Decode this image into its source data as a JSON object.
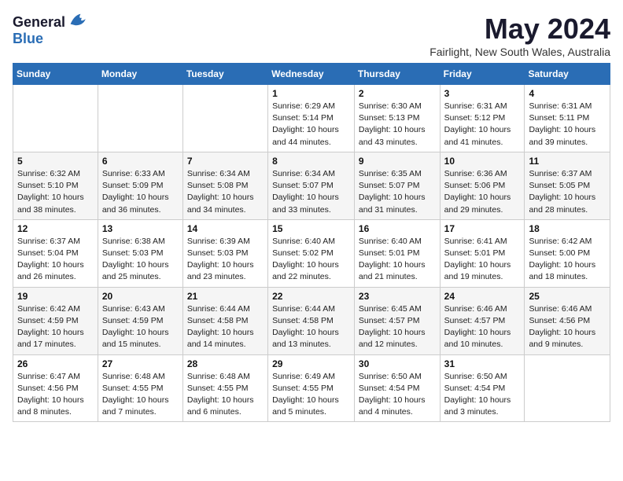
{
  "logo": {
    "general": "General",
    "blue": "Blue"
  },
  "title": "May 2024",
  "location": "Fairlight, New South Wales, Australia",
  "days_of_week": [
    "Sunday",
    "Monday",
    "Tuesday",
    "Wednesday",
    "Thursday",
    "Friday",
    "Saturday"
  ],
  "weeks": [
    [
      {
        "day": "",
        "info": ""
      },
      {
        "day": "",
        "info": ""
      },
      {
        "day": "",
        "info": ""
      },
      {
        "day": "1",
        "info": "Sunrise: 6:29 AM\nSunset: 5:14 PM\nDaylight: 10 hours and 44 minutes."
      },
      {
        "day": "2",
        "info": "Sunrise: 6:30 AM\nSunset: 5:13 PM\nDaylight: 10 hours and 43 minutes."
      },
      {
        "day": "3",
        "info": "Sunrise: 6:31 AM\nSunset: 5:12 PM\nDaylight: 10 hours and 41 minutes."
      },
      {
        "day": "4",
        "info": "Sunrise: 6:31 AM\nSunset: 5:11 PM\nDaylight: 10 hours and 39 minutes."
      }
    ],
    [
      {
        "day": "5",
        "info": "Sunrise: 6:32 AM\nSunset: 5:10 PM\nDaylight: 10 hours and 38 minutes."
      },
      {
        "day": "6",
        "info": "Sunrise: 6:33 AM\nSunset: 5:09 PM\nDaylight: 10 hours and 36 minutes."
      },
      {
        "day": "7",
        "info": "Sunrise: 6:34 AM\nSunset: 5:08 PM\nDaylight: 10 hours and 34 minutes."
      },
      {
        "day": "8",
        "info": "Sunrise: 6:34 AM\nSunset: 5:07 PM\nDaylight: 10 hours and 33 minutes."
      },
      {
        "day": "9",
        "info": "Sunrise: 6:35 AM\nSunset: 5:07 PM\nDaylight: 10 hours and 31 minutes."
      },
      {
        "day": "10",
        "info": "Sunrise: 6:36 AM\nSunset: 5:06 PM\nDaylight: 10 hours and 29 minutes."
      },
      {
        "day": "11",
        "info": "Sunrise: 6:37 AM\nSunset: 5:05 PM\nDaylight: 10 hours and 28 minutes."
      }
    ],
    [
      {
        "day": "12",
        "info": "Sunrise: 6:37 AM\nSunset: 5:04 PM\nDaylight: 10 hours and 26 minutes."
      },
      {
        "day": "13",
        "info": "Sunrise: 6:38 AM\nSunset: 5:03 PM\nDaylight: 10 hours and 25 minutes."
      },
      {
        "day": "14",
        "info": "Sunrise: 6:39 AM\nSunset: 5:03 PM\nDaylight: 10 hours and 23 minutes."
      },
      {
        "day": "15",
        "info": "Sunrise: 6:40 AM\nSunset: 5:02 PM\nDaylight: 10 hours and 22 minutes."
      },
      {
        "day": "16",
        "info": "Sunrise: 6:40 AM\nSunset: 5:01 PM\nDaylight: 10 hours and 21 minutes."
      },
      {
        "day": "17",
        "info": "Sunrise: 6:41 AM\nSunset: 5:01 PM\nDaylight: 10 hours and 19 minutes."
      },
      {
        "day": "18",
        "info": "Sunrise: 6:42 AM\nSunset: 5:00 PM\nDaylight: 10 hours and 18 minutes."
      }
    ],
    [
      {
        "day": "19",
        "info": "Sunrise: 6:42 AM\nSunset: 4:59 PM\nDaylight: 10 hours and 17 minutes."
      },
      {
        "day": "20",
        "info": "Sunrise: 6:43 AM\nSunset: 4:59 PM\nDaylight: 10 hours and 15 minutes."
      },
      {
        "day": "21",
        "info": "Sunrise: 6:44 AM\nSunset: 4:58 PM\nDaylight: 10 hours and 14 minutes."
      },
      {
        "day": "22",
        "info": "Sunrise: 6:44 AM\nSunset: 4:58 PM\nDaylight: 10 hours and 13 minutes."
      },
      {
        "day": "23",
        "info": "Sunrise: 6:45 AM\nSunset: 4:57 PM\nDaylight: 10 hours and 12 minutes."
      },
      {
        "day": "24",
        "info": "Sunrise: 6:46 AM\nSunset: 4:57 PM\nDaylight: 10 hours and 10 minutes."
      },
      {
        "day": "25",
        "info": "Sunrise: 6:46 AM\nSunset: 4:56 PM\nDaylight: 10 hours and 9 minutes."
      }
    ],
    [
      {
        "day": "26",
        "info": "Sunrise: 6:47 AM\nSunset: 4:56 PM\nDaylight: 10 hours and 8 minutes."
      },
      {
        "day": "27",
        "info": "Sunrise: 6:48 AM\nSunset: 4:55 PM\nDaylight: 10 hours and 7 minutes."
      },
      {
        "day": "28",
        "info": "Sunrise: 6:48 AM\nSunset: 4:55 PM\nDaylight: 10 hours and 6 minutes."
      },
      {
        "day": "29",
        "info": "Sunrise: 6:49 AM\nSunset: 4:55 PM\nDaylight: 10 hours and 5 minutes."
      },
      {
        "day": "30",
        "info": "Sunrise: 6:50 AM\nSunset: 4:54 PM\nDaylight: 10 hours and 4 minutes."
      },
      {
        "day": "31",
        "info": "Sunrise: 6:50 AM\nSunset: 4:54 PM\nDaylight: 10 hours and 3 minutes."
      },
      {
        "day": "",
        "info": ""
      }
    ]
  ]
}
